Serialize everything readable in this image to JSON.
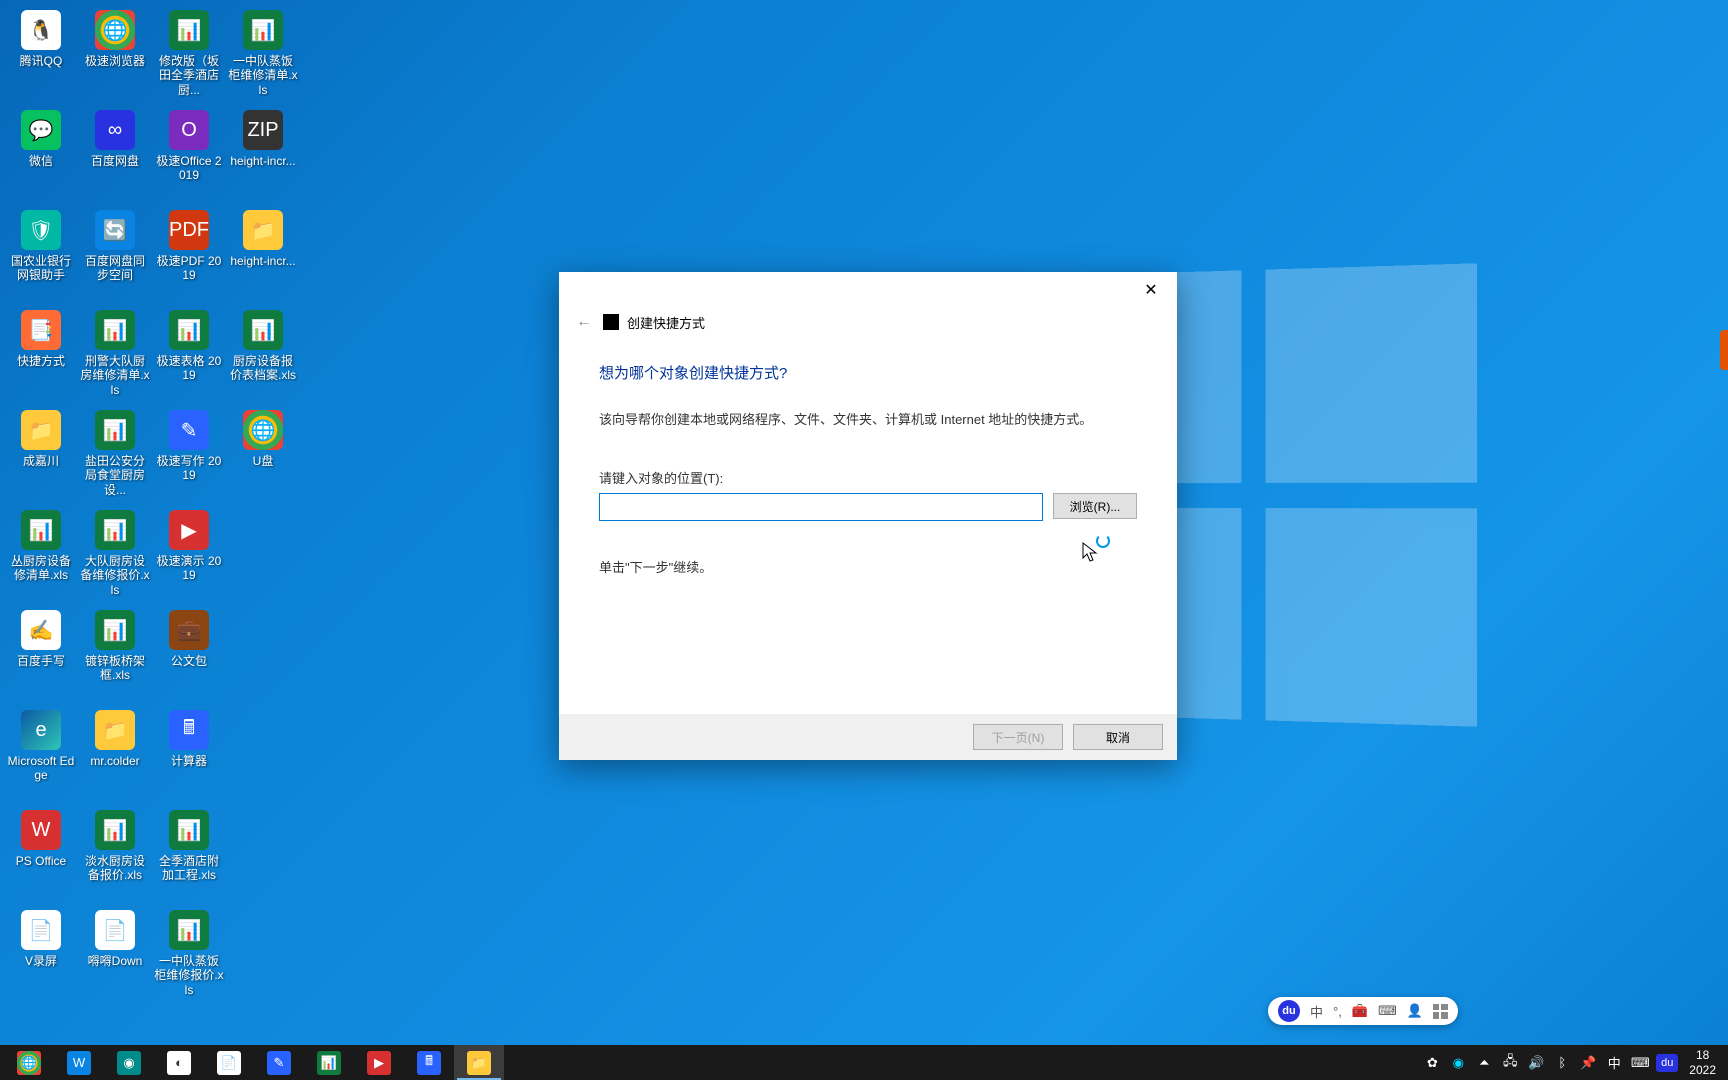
{
  "desktop_icons": [
    {
      "label": "腾讯QQ",
      "cls": "bg-qq",
      "glyph": "🐧"
    },
    {
      "label": "微信",
      "cls": "bg-wechat",
      "glyph": "💬"
    },
    {
      "label": "国农业银行网银助手",
      "cls": "bg-shield",
      "glyph": "🛡"
    },
    {
      "label": "快捷方式",
      "cls": "bg-orange",
      "glyph": "📑"
    },
    {
      "label": "成嘉川",
      "cls": "bg-folder",
      "glyph": "📁"
    },
    {
      "label": "丛厨房设备修清单.xls",
      "cls": "bg-xls",
      "glyph": "📊"
    },
    {
      "label": "百度手写",
      "cls": "bg-white",
      "glyph": "✍"
    },
    {
      "label": "Microsoft Edge",
      "cls": "bg-edge",
      "glyph": "e"
    },
    {
      "label": "PS Office",
      "cls": "bg-red",
      "glyph": "W"
    },
    {
      "label": "V录屏",
      "cls": "bg-white",
      "glyph": "📄"
    },
    {
      "label": "极速浏览器",
      "cls": "bg-chrome",
      "glyph": "🌐"
    },
    {
      "label": "百度网盘",
      "cls": "bg-baidu",
      "glyph": "∞"
    },
    {
      "label": "百度网盘同步空间",
      "cls": "bg-blue",
      "glyph": "🔄"
    },
    {
      "label": "刑警大队厨房维修清单.xls",
      "cls": "bg-xls",
      "glyph": "📊"
    },
    {
      "label": "盐田公安分局食堂厨房设...",
      "cls": "bg-xls",
      "glyph": "📊"
    },
    {
      "label": "大队厨房设备维修报价.xls",
      "cls": "bg-xls",
      "glyph": "📊"
    },
    {
      "label": "镀锌板桥架框.xls",
      "cls": "bg-xls",
      "glyph": "📊"
    },
    {
      "label": "mr.colder",
      "cls": "bg-folder",
      "glyph": "📁"
    },
    {
      "label": "淡水厨房设备报价.xls",
      "cls": "bg-xls",
      "glyph": "📊"
    },
    {
      "label": "嘚嘚Down",
      "cls": "bg-white",
      "glyph": "📄"
    },
    {
      "label": "修改版（坂田全季酒店厨...",
      "cls": "bg-xls",
      "glyph": "📊"
    },
    {
      "label": "极速Office 2019",
      "cls": "bg-purple",
      "glyph": "O"
    },
    {
      "label": "极速PDF 2019",
      "cls": "bg-pdf",
      "glyph": "PDF"
    },
    {
      "label": "极速表格 2019",
      "cls": "bg-xls",
      "glyph": "📊"
    },
    {
      "label": "极速写作 2019",
      "cls": "bg-blue2",
      "glyph": "✎"
    },
    {
      "label": "极速演示 2019",
      "cls": "bg-red",
      "glyph": "▶"
    },
    {
      "label": "公文包",
      "cls": "bg-brown",
      "glyph": "💼"
    },
    {
      "label": "计算器",
      "cls": "bg-blue2",
      "glyph": "🖩"
    },
    {
      "label": "全季酒店附加工程.xls",
      "cls": "bg-xls",
      "glyph": "📊"
    },
    {
      "label": "一中队蒸饭柜维修报价.xls",
      "cls": "bg-xls",
      "glyph": "📊"
    },
    {
      "label": "一中队蒸饭柜维修清单.xls",
      "cls": "bg-xls",
      "glyph": "📊"
    },
    {
      "label": "height-incr...",
      "cls": "bg-zip",
      "glyph": "ZIP"
    },
    {
      "label": "height-incr...",
      "cls": "bg-folder",
      "glyph": "📁"
    },
    {
      "label": "厨房设备报价表档案.xls",
      "cls": "bg-xls",
      "glyph": "📊"
    },
    {
      "label": "U盘",
      "cls": "bg-chrome",
      "glyph": "🌐"
    }
  ],
  "dialog": {
    "title": "创建快捷方式",
    "heading": "想为哪个对象创建快捷方式?",
    "description": "该向导帮你创建本地或网络程序、文件、文件夹、计算机或 Internet 地址的快捷方式。",
    "location_label": "请键入对象的位置(T):",
    "browse_btn": "浏览(R)...",
    "hint": "单击\"下一步\"继续。",
    "next_btn": "下一页(N)",
    "cancel_btn": "取消",
    "input_value": ""
  },
  "float_widget": {
    "logo_text": "du",
    "ime_text": "中"
  },
  "taskbar_items": [
    {
      "cls": "bg-chrome",
      "glyph": "🌐",
      "active": false
    },
    {
      "cls": "bg-blue",
      "glyph": "W",
      "active": false
    },
    {
      "cls": "bg-teal",
      "glyph": "◉",
      "active": false
    },
    {
      "cls": "bg-white",
      "glyph": "◐",
      "active": false
    },
    {
      "cls": "bg-white",
      "glyph": "📄",
      "active": false
    },
    {
      "cls": "bg-blue2",
      "glyph": "✎",
      "active": false
    },
    {
      "cls": "bg-xls",
      "glyph": "📊",
      "active": false
    },
    {
      "cls": "bg-red",
      "glyph": "▶",
      "active": false
    },
    {
      "cls": "bg-blue2",
      "glyph": "🖩",
      "active": false
    },
    {
      "cls": "bg-folder",
      "glyph": "📁",
      "active": true
    }
  ],
  "tray": {
    "ime": "中",
    "baidu": "du",
    "time": "18",
    "date": "2022"
  }
}
